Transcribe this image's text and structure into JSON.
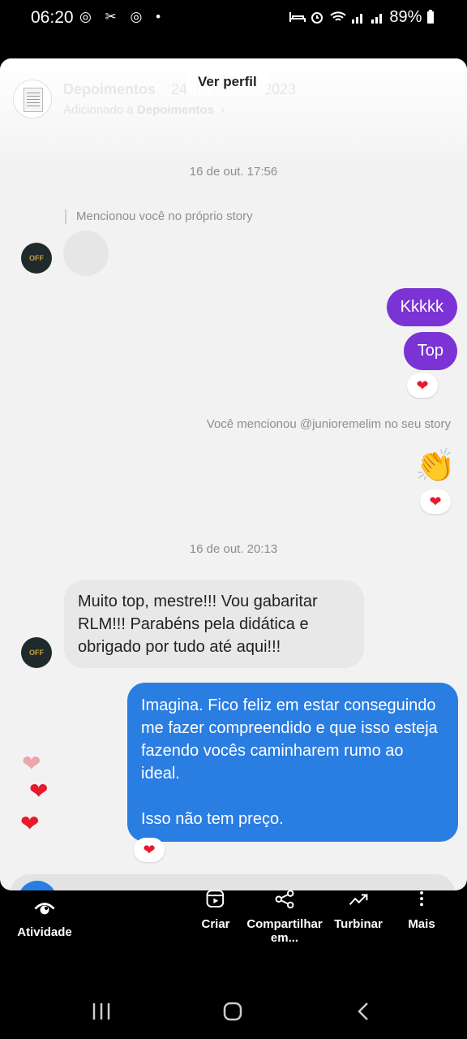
{
  "status_bar": {
    "time": "06:20",
    "left_icons": "◎ ✂ ◎ •",
    "battery": "89%"
  },
  "story": {
    "highlight_title": "Depoimentos",
    "date": "24 de abril de 2023",
    "added_prefix": "Adicionado a ",
    "added_name": "Depoimentos",
    "view_profile": "Ver perfil"
  },
  "chat": {
    "timestamp_1": "16 de out. 17:56",
    "mention_label": "Mencionou você no próprio story",
    "avatar_text": "OFF",
    "msg_kkkkk": "Kkkkk",
    "msg_top": "Top",
    "you_mentioned": "Você mencionou @junioremelim no seu story",
    "emoji_clap": "👏",
    "timestamp_2": "16 de out. 20:13",
    "incoming": "Muito top, mestre!!! Vou gabaritar RLM!!! Parabéns pela didática e obrigado por tudo até aqui!!!",
    "outgoing_p1": "Imagina. Fico feliz em estar conseguindo me fazer compreendido e que isso esteja fazendo vocês caminharem rumo ao ideal.",
    "outgoing_p2": "Isso não tem preço.",
    "heart": "❤"
  },
  "bottom_menu": {
    "activity": "Atividade",
    "create": "Criar",
    "share_line1": "Compartilhar",
    "share_line2": "em...",
    "boost": "Turbinar",
    "more": "Mais"
  },
  "colors": {
    "purple_bubble": "#7b33d6",
    "blue_bubble": "#2a7de1",
    "heart_red": "#e8192c"
  }
}
